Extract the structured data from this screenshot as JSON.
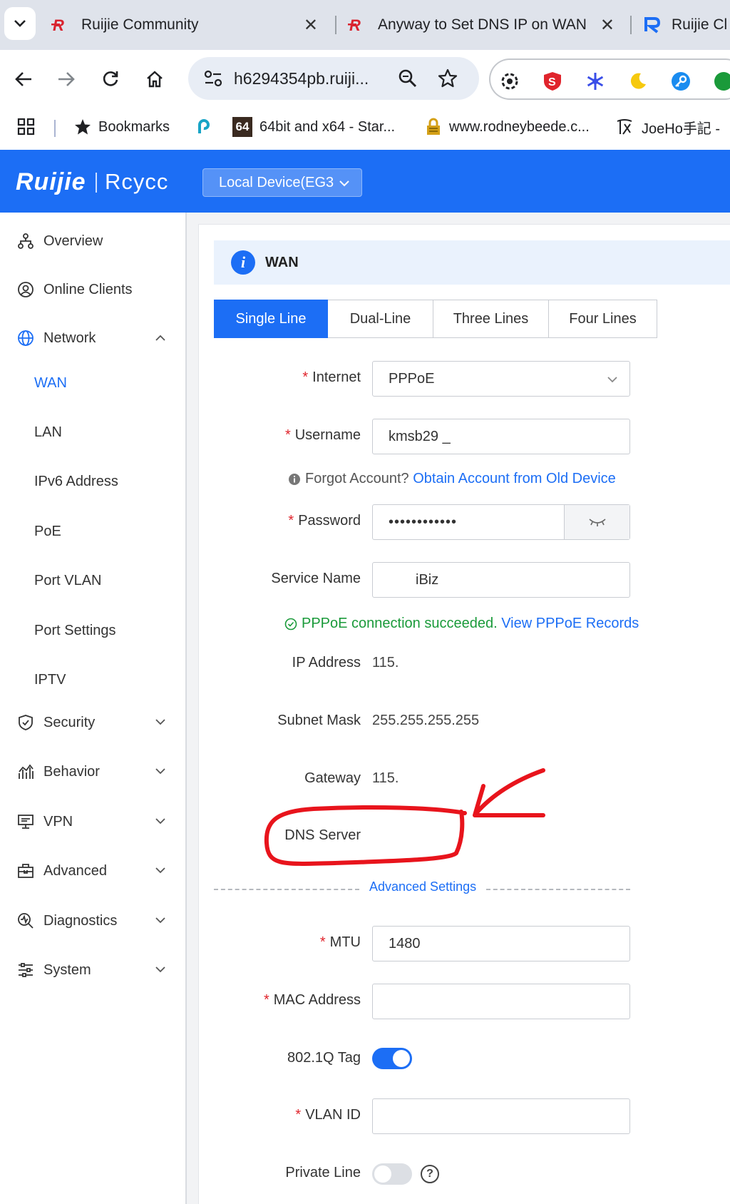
{
  "browser": {
    "tabs": [
      {
        "title": "Ruijie Community",
        "close": "✕"
      },
      {
        "title": "Anyway to Set DNS IP on WAN",
        "close": "✕"
      },
      {
        "title": "Ruijie Cl"
      }
    ],
    "url": "h6294354pb.ruiji...",
    "bookmarks": [
      {
        "label": "Bookmarks"
      },
      {
        "label": "64bit and x64 - Star..."
      },
      {
        "label": "www.rodneybeede.c..."
      },
      {
        "label": "JoeHo手記 - "
      }
    ],
    "icon_badge_64": "64"
  },
  "header": {
    "logo_primary": "Ruijie",
    "logo_secondary": "Rcycc",
    "device_label": "Local Device(EG3"
  },
  "sidebar": {
    "items": [
      {
        "label": "Overview"
      },
      {
        "label": "Online Clients"
      },
      {
        "label": "Network"
      },
      {
        "label": "Security"
      },
      {
        "label": "Behavior"
      },
      {
        "label": "VPN"
      },
      {
        "label": "Advanced"
      },
      {
        "label": "Diagnostics"
      },
      {
        "label": "System"
      }
    ],
    "network_sub": [
      {
        "label": "WAN"
      },
      {
        "label": "LAN"
      },
      {
        "label": "IPv6 Address"
      },
      {
        "label": "PoE"
      },
      {
        "label": "Port VLAN"
      },
      {
        "label": "Port Settings"
      },
      {
        "label": "IPTV"
      }
    ]
  },
  "page": {
    "info_glyph": "i",
    "title": "WAN",
    "tabs": [
      {
        "label": "Single Line"
      },
      {
        "label": "Dual-Line"
      },
      {
        "label": "Three Lines"
      },
      {
        "label": "Four Lines"
      }
    ],
    "required_mark": "*",
    "form": {
      "internet": {
        "label": "Internet",
        "value": "PPPoE"
      },
      "username": {
        "label": "Username",
        "value": "kmsb29 _"
      },
      "forgot": {
        "text": "Forgot Account?",
        "link": "Obtain Account from Old Device"
      },
      "password": {
        "label": "Password",
        "value": "••••••••••••"
      },
      "service_name": {
        "label": "Service Name",
        "value": "iBiz"
      },
      "pppoe_status": {
        "text": "PPPoE connection succeeded.",
        "link": "View PPPoE Records"
      },
      "ip_address": {
        "label": "IP Address",
        "value": "115."
      },
      "subnet_mask": {
        "label": "Subnet Mask",
        "value": "255.255.255.255"
      },
      "gateway": {
        "label": "Gateway",
        "value": "115."
      },
      "dns_server": {
        "label": "DNS Server",
        "value": ""
      },
      "advanced_settings": "Advanced Settings",
      "mtu": {
        "label": "MTU",
        "value": "1480"
      },
      "mac_address": {
        "label": "MAC Address",
        "value": ""
      },
      "tag_8021q": {
        "label": "802.1Q Tag",
        "enabled": true
      },
      "vlan_id": {
        "label": "VLAN ID",
        "value": ""
      },
      "private_line": {
        "label": "Private Line",
        "enabled": false,
        "help": "?"
      }
    }
  },
  "colors": {
    "brand_blue": "#1c6ef5",
    "success_green": "#1a9a3a",
    "annotation_red": "#e8141c"
  }
}
